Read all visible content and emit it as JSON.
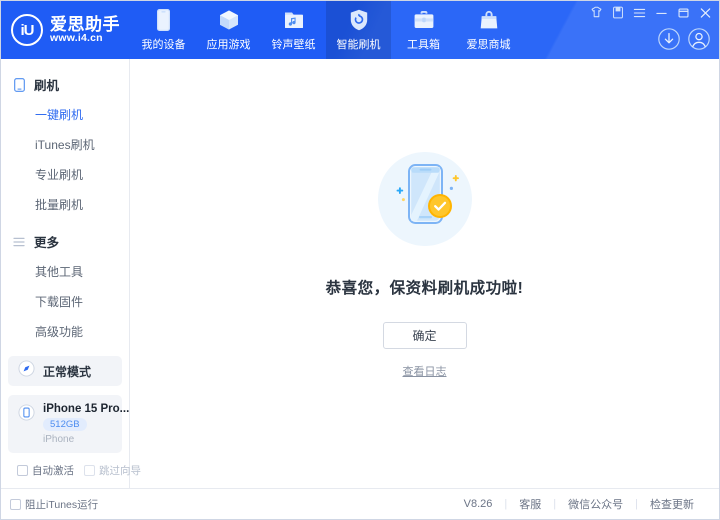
{
  "app": {
    "logo_mark": "iU",
    "logo_title": "爱思助手",
    "logo_url": "www.i4.cn"
  },
  "header": {
    "nav": [
      {
        "label": "我的设备",
        "icon": "phone-icon",
        "active": false
      },
      {
        "label": "应用游戏",
        "icon": "cube-icon",
        "active": false
      },
      {
        "label": "铃声壁纸",
        "icon": "music-folder-icon",
        "active": false
      },
      {
        "label": "智能刷机",
        "icon": "shield-refresh-icon",
        "active": true
      },
      {
        "label": "工具箱",
        "icon": "toolbox-icon",
        "active": false
      },
      {
        "label": "爱思商城",
        "icon": "shopping-bag-icon",
        "active": false
      }
    ],
    "window_controls": [
      "shirt-icon",
      "screen-icon",
      "menu-icon",
      "minimize-icon",
      "maximize-icon",
      "close-icon"
    ],
    "account_controls": [
      "download-icon",
      "user-avatar-icon"
    ]
  },
  "sidebar": {
    "groups": [
      {
        "label": "刷机",
        "icon": "phone-outline-icon",
        "items": [
          {
            "label": "一键刷机",
            "active": true
          },
          {
            "label": "iTunes刷机",
            "active": false
          },
          {
            "label": "专业刷机",
            "active": false
          },
          {
            "label": "批量刷机",
            "active": false
          }
        ]
      },
      {
        "label": "更多",
        "icon": "list-icon",
        "items": [
          {
            "label": "其他工具",
            "active": false
          },
          {
            "label": "下载固件",
            "active": false
          },
          {
            "label": "高级功能",
            "active": false
          }
        ]
      }
    ],
    "mode": {
      "label": "正常模式",
      "icon": "compass-icon"
    },
    "device": {
      "name": "iPhone 15 Pro...",
      "capacity": "512GB",
      "type": "iPhone",
      "icon": "device-icon"
    },
    "checks": [
      {
        "label": "自动激活",
        "checked": false,
        "dim": false
      },
      {
        "label": "跳过向导",
        "checked": false,
        "dim": true
      }
    ]
  },
  "main": {
    "illustration": "phone-success-illustration",
    "message": "恭喜您，保资料刷机成功啦!",
    "confirm_label": "确定",
    "log_link": "查看日志"
  },
  "footer": {
    "block_itunes": {
      "label": "阻止iTunes运行",
      "checked": false
    },
    "version": "V8.26",
    "links": [
      "客服",
      "微信公众号",
      "检查更新"
    ]
  },
  "colors": {
    "brand_blue": "#1f5cf5",
    "accent_link": "#2f6bf0",
    "badge_blue": "#4d8df0",
    "check_gold": "#ffb921"
  }
}
